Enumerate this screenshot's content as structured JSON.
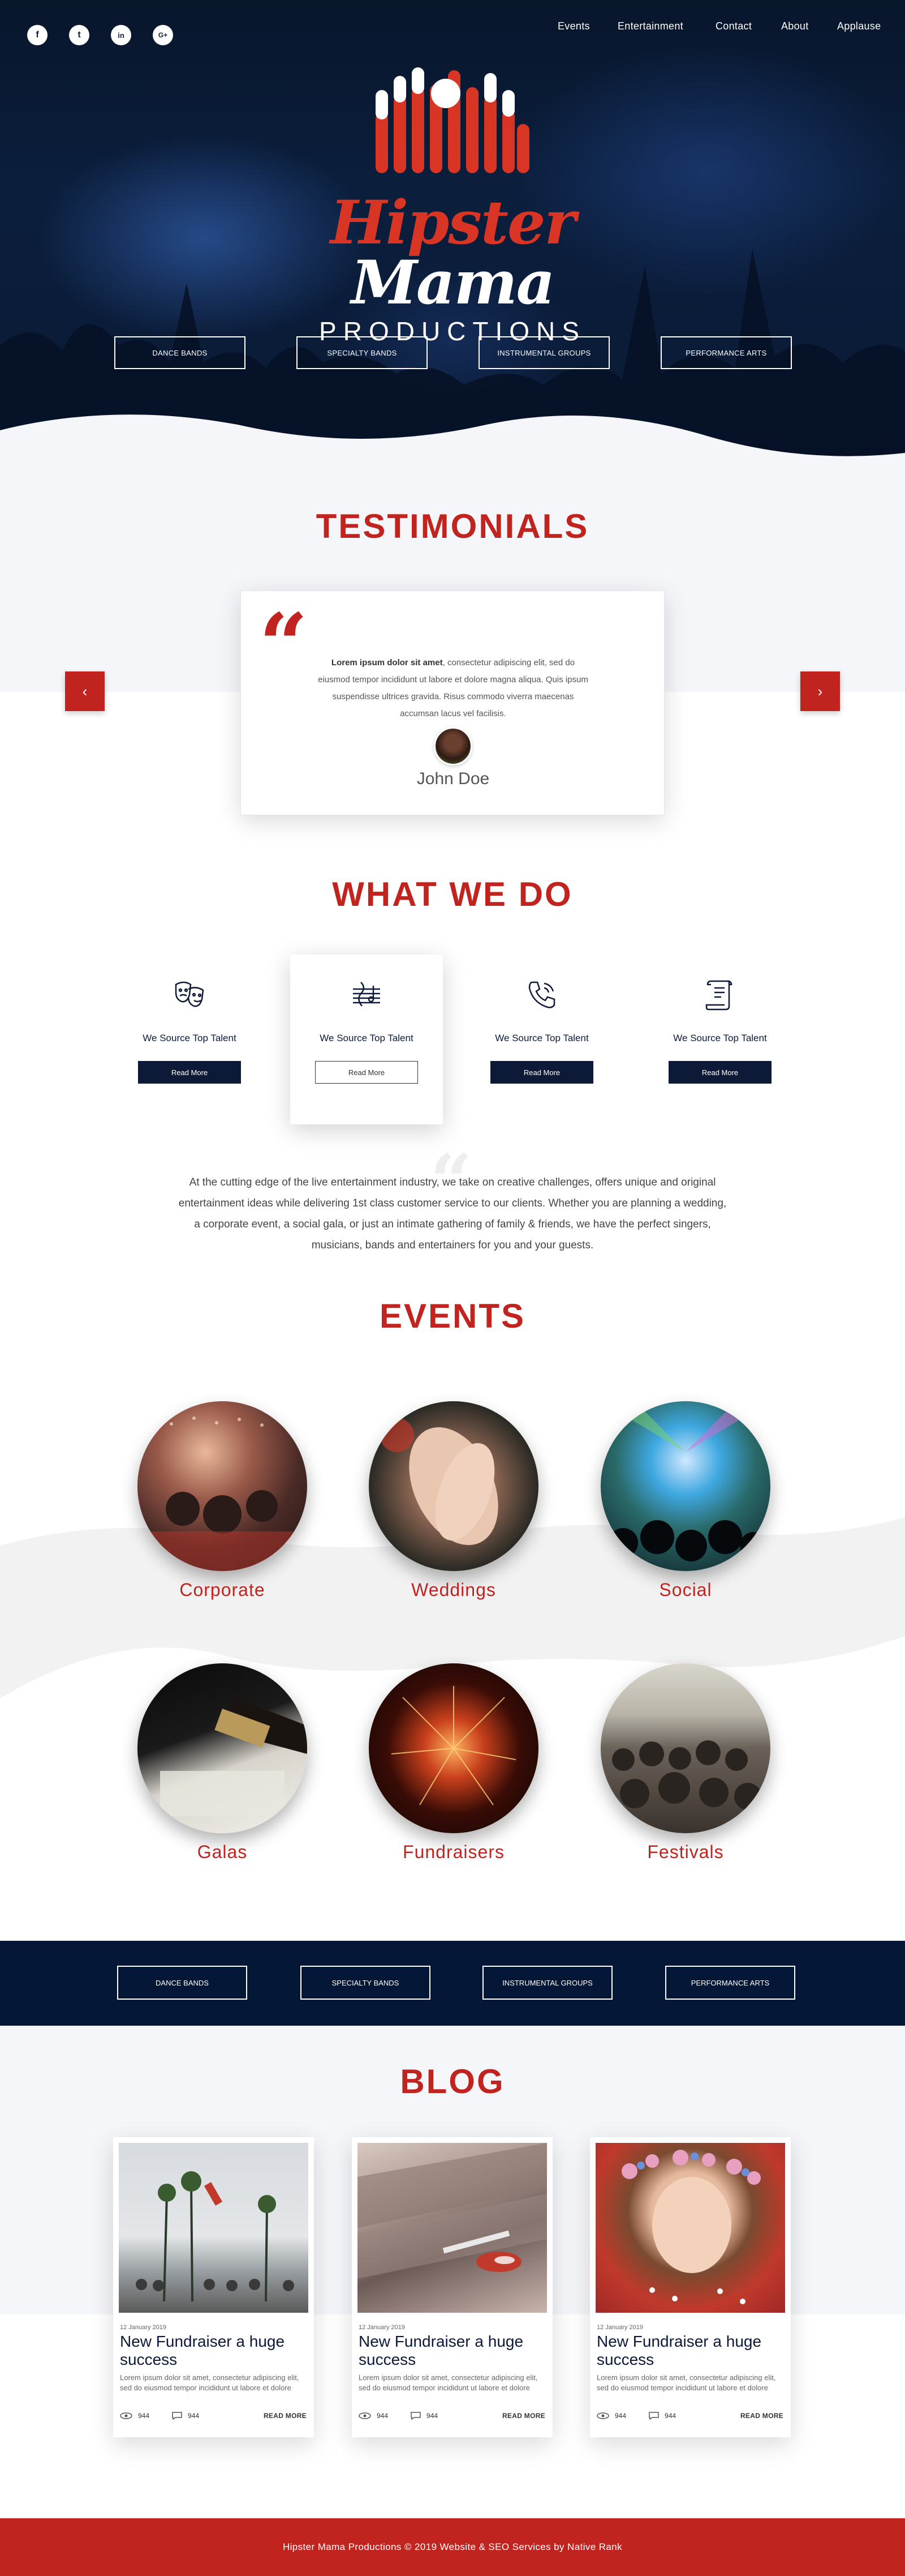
{
  "social": [
    "f",
    "t",
    "in",
    "G+"
  ],
  "nav": [
    "Events",
    "Entertainment",
    "Contact",
    "About",
    "Applause"
  ],
  "logo": {
    "script_a": "Hipster",
    "script_b": "Mama",
    "sub": "PRODUCTIONS"
  },
  "hero_buttons": [
    "Dance Bands",
    "Specialty Bands",
    "Instrumental Groups",
    "Performance Arts"
  ],
  "testimonials": {
    "title": "TESTIMONIALS",
    "bold": "Lorem ipsum dolor sit amet",
    "text": ", consectetur adipiscing elit, sed do eiusmod tempor incididunt ut labore et dolore magna aliqua. Quis ipsum suspendisse ultrices gravida. Risus commodo viverra maecenas accumsan lacus vel facilisis.",
    "name": "John Doe",
    "prev": "‹",
    "next": "›"
  },
  "what_we_do": {
    "title": "WHAT WE DO",
    "services": [
      {
        "label": "We Source Top Talent",
        "button": "Read More"
      },
      {
        "label": "We Source Top Talent",
        "button": "Read More"
      },
      {
        "label": "We Source Top Talent",
        "button": "Read More"
      },
      {
        "label": "We Source Top Talent",
        "button": "Read More"
      }
    ],
    "intro": "At the cutting edge of the live entertainment industry, we take on creative challenges, offers unique and original entertainment ideas while delivering 1st class customer service to our clients. Whether you are planning a wedding, a corporate event, a social gala, or just an intimate gathering of family & friends, we have the perfect singers, musicians, bands and entertainers for you and your guests."
  },
  "events": {
    "title": "EVENTS",
    "items": [
      "Corporate",
      "Weddings",
      "Social",
      "Galas",
      "Fundraisers",
      "Festivals"
    ]
  },
  "band_buttons": [
    "Dance Bands",
    "Specialty Bands",
    "Instrumental Groups",
    "Performance Arts"
  ],
  "blog": {
    "title": "BLOG",
    "posts": [
      {
        "date": "12 January 2019",
        "title": "New Fundraiser a huge success",
        "body": "Lorem ipsum dolor sit amet, consectetur adipiscing elit, sed do eiusmod tempor incididunt ut labore et dolore",
        "views": "944",
        "comments": "944",
        "more": "READ MORE"
      },
      {
        "date": "12 January 2019",
        "title": "New Fundraiser a huge success",
        "body": "Lorem ipsum dolor sit amet, consectetur adipiscing elit, sed do eiusmod tempor incididunt ut labore et dolore",
        "views": "944",
        "comments": "944",
        "more": "READ MORE"
      },
      {
        "date": "12 January 2019",
        "title": "New Fundraiser a huge success",
        "body": "Lorem ipsum dolor sit amet, consectetur adipiscing elit, sed do eiusmod tempor incididunt ut labore et dolore",
        "views": "944",
        "comments": "944",
        "more": "READ MORE"
      }
    ]
  },
  "footer": "Hipster Mama Productions © 2019 Website & SEO Services by Native Rank",
  "colors": {
    "accent": "#c1231f",
    "navy": "#041736"
  }
}
